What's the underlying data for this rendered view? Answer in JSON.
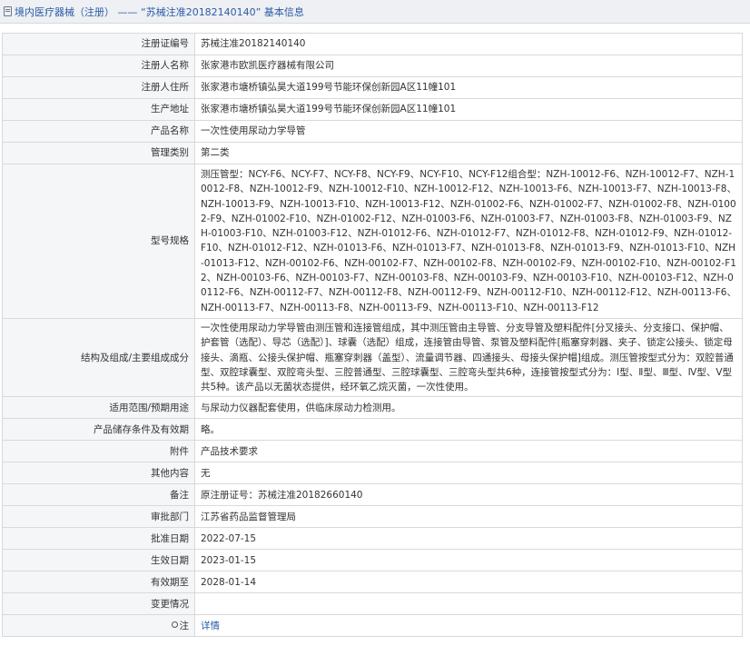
{
  "header": {
    "title": "境内医疗器械（注册） —— “苏械注准20182140140” 基本信息"
  },
  "rows": [
    {
      "label": "注册证编号",
      "value": "苏械注准20182140140"
    },
    {
      "label": "注册人名称",
      "value": "张家港市欧凯医疗器械有限公司"
    },
    {
      "label": "注册人住所",
      "value": "张家港市塘桥镇弘昊大道199号节能环保创新园A区11幢101"
    },
    {
      "label": "生产地址",
      "value": "张家港市塘桥镇弘昊大道199号节能环保创新园A区11幢101"
    },
    {
      "label": "产品名称",
      "value": "一次性使用尿动力学导管"
    },
    {
      "label": "管理类别",
      "value": "第二类"
    },
    {
      "label": "型号规格",
      "value": "测压管型：NCY-F6、NCY-F7、NCY-F8、NCY-F9、NCY-F10、NCY-F12组合型：NZH-10012-F6、NZH-10012-F7、NZH-10012-F8、NZH-10012-F9、NZH-10012-F10、NZH-10012-F12、NZH-10013-F6、NZH-10013-F7、NZH-10013-F8、NZH-10013-F9、NZH-10013-F10、NZH-10013-F12、NZH-01002-F6、NZH-01002-F7、NZH-01002-F8、NZH-01002-F9、NZH-01002-F10、NZH-01002-F12、NZH-01003-F6、NZH-01003-F7、NZH-01003-F8、NZH-01003-F9、NZH-01003-F10、NZH-01003-F12、NZH-01012-F6、NZH-01012-F7、NZH-01012-F8、NZH-01012-F9、NZH-01012-F10、NZH-01012-F12、NZH-01013-F6、NZH-01013-F7、NZH-01013-F8、NZH-01013-F9、NZH-01013-F10、NZH-01013-F12、NZH-00102-F6、NZH-00102-F7、NZH-00102-F8、NZH-00102-F9、NZH-00102-F10、NZH-00102-F12、NZH-00103-F6、NZH-00103-F7、NZH-00103-F8、NZH-00103-F9、NZH-00103-F10、NZH-00103-F12、NZH-00112-F6、NZH-00112-F7、NZH-00112-F8、NZH-00112-F9、NZH-00112-F10、NZH-00112-F12、NZH-00113-F6、NZH-00113-F7、NZH-00113-F8、NZH-00113-F9、NZH-00113-F10、NZH-00113-F12"
    },
    {
      "label": "结构及组成/主要组成成分",
      "value": "一次性使用尿动力学导管由测压管和连接管组成，其中测压管由主导管、分支导管及塑料配件[分叉接头、分支接口、保护帽、护套管（选配）、导芯（选配）]、球囊（选配）组成，连接管由导管、泵管及塑料配件[瓶塞穿刺器、夹子、锁定公接头、锁定母接头、滴瓶、公接头保护帽、瓶塞穿刺器（盖型）、流量调节器、四通接头、母接头保护帽]组成。测压管按型式分为：双腔普通型、双腔球囊型、双腔弯头型、三腔普通型、三腔球囊型、三腔弯头型共6种，连接管按型式分为：Ⅰ型、Ⅱ型、Ⅲ型、Ⅳ型、Ⅴ型共5种。该产品以无菌状态提供，经环氧乙烷灭菌，一次性使用。"
    },
    {
      "label": "适用范围/预期用途",
      "value": "与尿动力仪器配套使用，供临床尿动力检测用。"
    },
    {
      "label": "产品储存条件及有效期",
      "value": "略。"
    },
    {
      "label": "附件",
      "value": "产品技术要求"
    },
    {
      "label": "其他内容",
      "value": "无"
    },
    {
      "label": "备注",
      "value": "原注册证号：苏械注准20182660140"
    },
    {
      "label": "审批部门",
      "value": "江苏省药品监督管理局"
    },
    {
      "label": "批准日期",
      "value": "2022-07-15"
    },
    {
      "label": "生效日期",
      "value": "2023-01-15"
    },
    {
      "label": "有效期至",
      "value": "2028-01-14"
    },
    {
      "label": "变更情况",
      "value": ""
    }
  ],
  "footer_row": {
    "label": "注",
    "link": "详情",
    "icon": "pin-icon"
  }
}
